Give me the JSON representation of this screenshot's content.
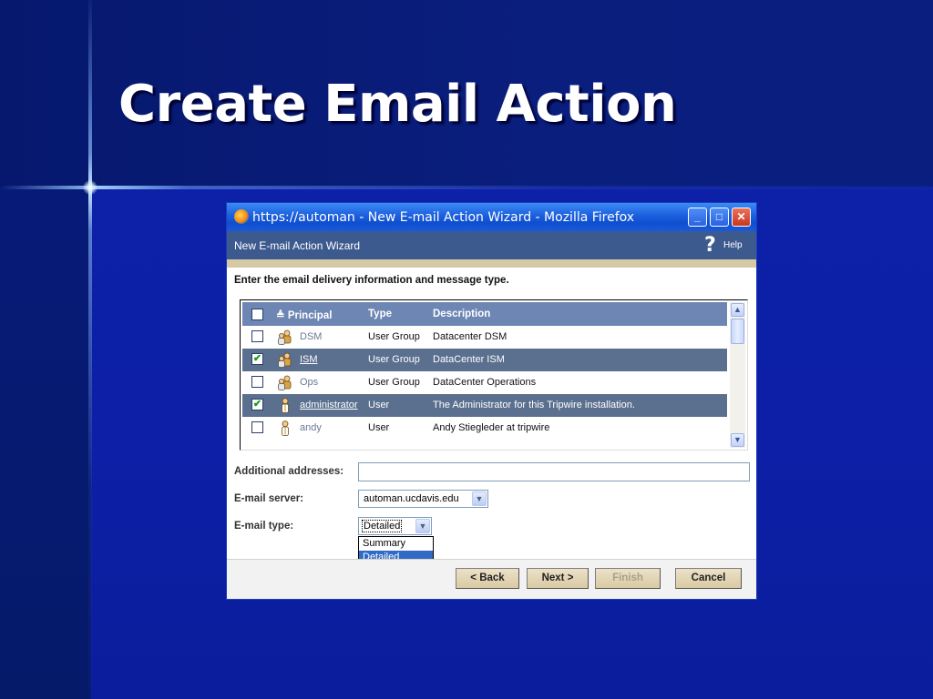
{
  "slide": {
    "title": "Create Email Action"
  },
  "window": {
    "title": "https://automan - New E-mail Action Wizard - Mozilla Firefox",
    "controls": {
      "minimize": "_",
      "maximize": "□",
      "close": "✕"
    }
  },
  "wizard": {
    "title": "New E-mail Action Wizard",
    "help_label": "Help",
    "help_icon": "?",
    "instruction": "Enter the email delivery information and message type."
  },
  "table": {
    "headers": {
      "principal": "Principal",
      "type": "Type",
      "description": "Description",
      "sort_glyph": "≜"
    },
    "rows": [
      {
        "checked": false,
        "icon": "user-group-icon",
        "name": "DSM",
        "type": "User Group",
        "description": "Datacenter DSM"
      },
      {
        "checked": true,
        "icon": "user-group-icon",
        "name": "ISM",
        "type": "User Group",
        "description": "DataCenter ISM"
      },
      {
        "checked": false,
        "icon": "user-group-icon",
        "name": "Ops",
        "type": "User Group",
        "description": "DataCenter Operations"
      },
      {
        "checked": true,
        "icon": "user-icon",
        "name": "administrator",
        "type": "User",
        "description": "The Administrator for this Tripwire installation."
      },
      {
        "checked": false,
        "icon": "user-icon",
        "name": "andy",
        "type": "User",
        "description": "Andy Stiegleder at tripwire"
      }
    ],
    "check_glyph": "✔"
  },
  "form": {
    "additional_addresses": {
      "label": "Additional addresses:",
      "value": ""
    },
    "email_server": {
      "label": "E-mail server:",
      "value": "automan.ucdavis.edu"
    },
    "email_type": {
      "label": "E-mail type:",
      "value": "Detailed",
      "options": [
        "Summary",
        "Detailed"
      ]
    },
    "dropdown_arrow": "▼"
  },
  "buttons": {
    "back": "< Back",
    "next": "Next >",
    "finish": "Finish",
    "cancel": "Cancel"
  },
  "scroll": {
    "up": "▲",
    "down": "▼"
  }
}
